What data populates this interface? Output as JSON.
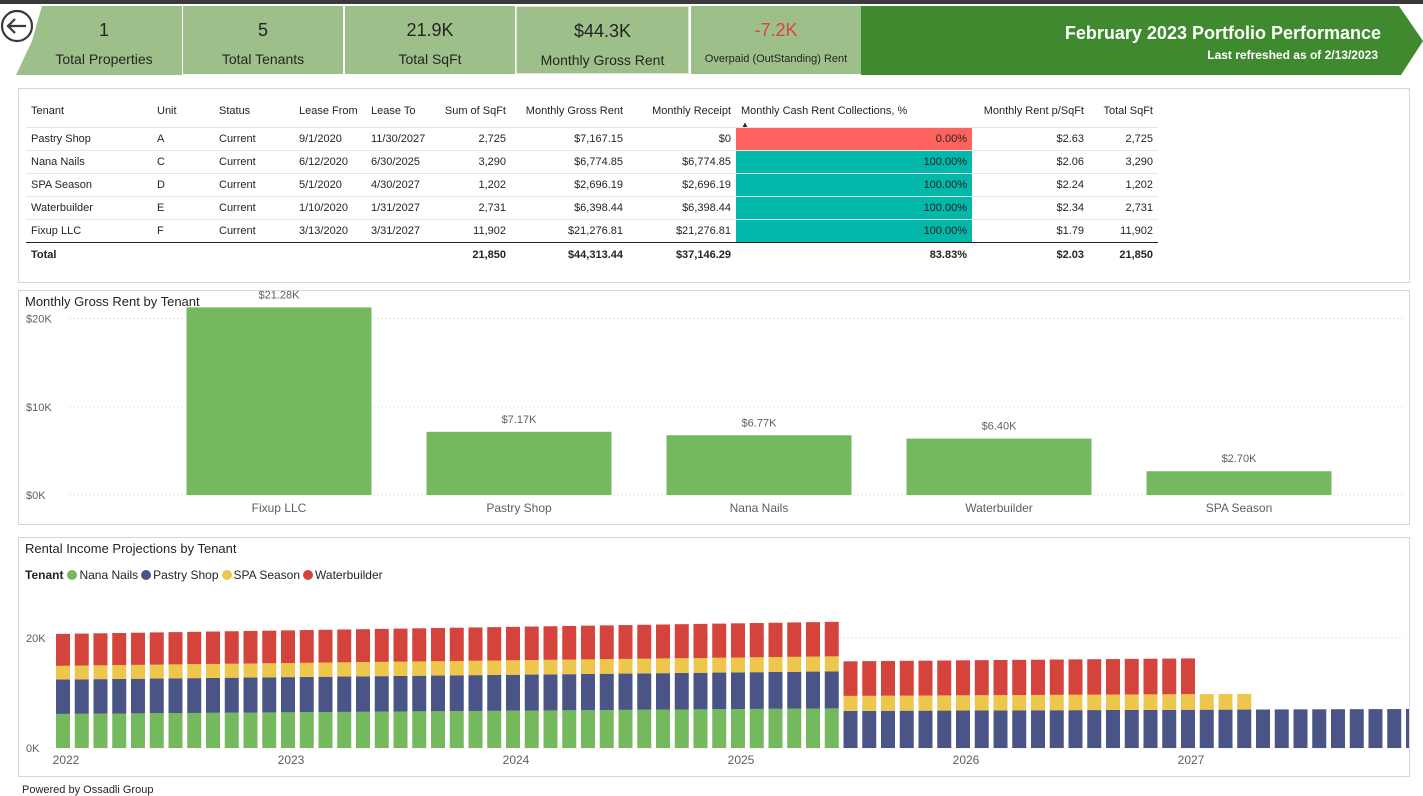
{
  "kpis": [
    {
      "value": "1",
      "label": "Total Properties"
    },
    {
      "value": "5",
      "label": "Total Tenants"
    },
    {
      "value": "21.9K",
      "label": "Total SqFt"
    },
    {
      "value": "$44.3K",
      "label": "Monthly Gross Rent"
    },
    {
      "value": "-7.2K",
      "label": "Overpaid (OutStanding) Rent"
    }
  ],
  "banner": {
    "title": "February 2023 Portfolio Performance",
    "subtitle": "Last refreshed as of 2/13/2023",
    "color": "#3f8a2e"
  },
  "table": {
    "headers": [
      "Tenant",
      "Unit",
      "Status",
      "Lease From",
      "Lease To",
      "Sum of SqFt",
      "Monthly Gross Rent",
      "Monthly Receipt",
      "Monthly Cash Rent Collections, %",
      "Monthly Rent p/SqFt",
      "Total SqFt"
    ],
    "rows": [
      [
        "Pastry Shop",
        "A",
        "Current",
        "9/1/2020",
        "11/30/2027",
        "2,725",
        "$7,167.15",
        "$0",
        "0.00%",
        "$2.63",
        "2,725"
      ],
      [
        "Nana Nails",
        "C",
        "Current",
        "6/12/2020",
        "6/30/2025",
        "3,290",
        "$6,774.85",
        "$6,774.85",
        "100.00%",
        "$2.06",
        "3,290"
      ],
      [
        "SPA Season",
        "D",
        "Current",
        "5/1/2020",
        "4/30/2027",
        "1,202",
        "$2,696.19",
        "$2,696.19",
        "100.00%",
        "$2.24",
        "1,202"
      ],
      [
        "Waterbuilder",
        "E",
        "Current",
        "1/10/2020",
        "1/31/2027",
        "2,731",
        "$6,398.44",
        "$6,398.44",
        "100.00%",
        "$2.34",
        "2,731"
      ],
      [
        "Fixup LLC",
        "F",
        "Current",
        "3/13/2020",
        "3/31/2027",
        "11,902",
        "$21,276.81",
        "$21,276.81",
        "100.00%",
        "$1.79",
        "11,902"
      ]
    ],
    "total": [
      "Total",
      "",
      "",
      "",
      "",
      "21,850",
      "$44,313.44",
      "$37,146.29",
      "83.83%",
      "$2.03",
      "21,850"
    ]
  },
  "colors": {
    "kpi_bg": "#9dc08b",
    "low_collection": "#fd625e",
    "full_collection": "#01b8aa",
    "bar_green": "#74b95e"
  },
  "chart_data": [
    {
      "type": "bar",
      "title": "Monthly Gross Rent by Tenant",
      "categories": [
        "Fixup LLC",
        "Pastry Shop",
        "Nana Nails",
        "Waterbuilder",
        "SPA Season"
      ],
      "values": [
        21276.81,
        7167.15,
        6774.85,
        6398.44,
        2696.19
      ],
      "data_labels": [
        "$21.28K",
        "$7.17K",
        "$6.77K",
        "$6.40K",
        "$2.70K"
      ],
      "yticks": [
        "$0K",
        "$10K",
        "$20K"
      ],
      "ylim": [
        0,
        22000
      ],
      "color": "#74b95e"
    },
    {
      "type": "bar",
      "stacked": true,
      "title": "Rental Income Projections by Tenant",
      "legend_title": "Tenant",
      "legend": [
        "Nana Nails",
        "Pastry Shop",
        "SPA Season",
        "Waterbuilder"
      ],
      "colors": {
        "Nana Nails": "#74b95e",
        "Pastry Shop": "#4a5486",
        "SPA Season": "#edc74b",
        "Waterbuilder": "#d5443c"
      },
      "x_tick_labels": [
        "2022",
        "2023",
        "2024",
        "2025",
        "2026",
        "2027"
      ],
      "y_tick_labels": [
        "0K",
        "20K"
      ],
      "ylim": [
        0,
        30000
      ],
      "x_start": "2022-01",
      "x_end": "2028-10",
      "segments": [
        {
          "tenant": "Nana Nails",
          "start": "2022-01",
          "end": "2025-06",
          "from": 6200,
          "to": 7200
        },
        {
          "tenant": "Pastry Shop",
          "start": "2022-01",
          "end": "2028-10",
          "from": 6250,
          "to": 7200
        },
        {
          "tenant": "SPA Season",
          "start": "2022-01",
          "end": "2027-04",
          "from": 2500,
          "to": 2850
        },
        {
          "tenant": "Waterbuilder",
          "start": "2022-01",
          "end": "2027-01",
          "from": 5800,
          "to": 6500
        }
      ]
    }
  ],
  "footer": "Powered by Ossadli Group"
}
